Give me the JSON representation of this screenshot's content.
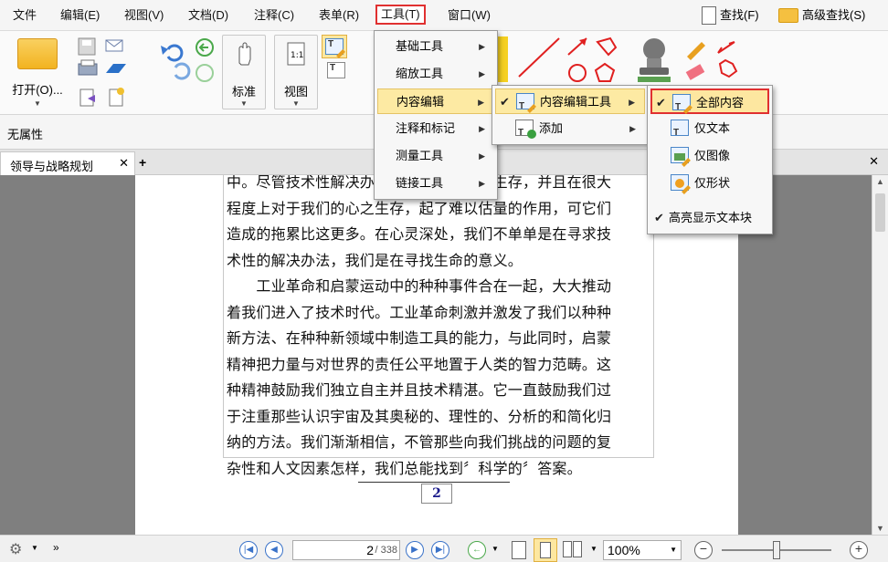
{
  "menubar": {
    "items": [
      "文件",
      "编辑(E)",
      "视图(V)",
      "文档(D)",
      "注释(C)",
      "表单(R)",
      "工具(T)",
      "窗口(W)"
    ],
    "search": "查找(F)",
    "advanced_search": "高级查找(S)"
  },
  "ribbon": {
    "open_label": "打开(O)...",
    "standard_label": "标准",
    "view_label": "视图"
  },
  "propbar": {
    "label": "无属性"
  },
  "tab": {
    "title": "领导与战略规划"
  },
  "tools_menu": {
    "items": [
      "基础工具",
      "缩放工具",
      "内容编辑",
      "注释和标记",
      "测量工具",
      "链接工具"
    ]
  },
  "content_edit_menu": {
    "items": [
      "内容编辑工具",
      "添加"
    ]
  },
  "content_edit_tools_menu": {
    "items": [
      "全部内容",
      "仅文本",
      "仅图像",
      "仅形状",
      "高亮显示文本块"
    ]
  },
  "document": {
    "lines": [
      "中。尽管技术性解决办法对我们的肉体之生存，并且在很大",
      "程度上对于我们的心之生存，起了难以估量的作用，可它们",
      "造成的拖累比这更多。在心灵深处，我们不单单是在寻求技",
      "术性的解决办法，我们是在寻找生命的意义。",
      "　　工业革命和启蒙运动中的种种事件合在一起，大大推动",
      "着我们进入了技术时代。工业革命刺激并激发了我们以种种",
      "新方法、在种种新领域中制造工具的能力，与此同时，启蒙",
      "精神把力量与对世界的责任公平地置于人类的智力范畴。这",
      "种精神鼓励我们独立自主并且技术精湛。它一直鼓励我们过",
      "于注重那些认识宇宙及其奥秘的、理性的、分析的和简化归",
      "纳的方法。我们渐渐相信，不管那些向我们挑战的问题的复",
      "杂性和人文因素怎样，我们总能找到〞科学的〞答案。"
    ],
    "page_number": "2"
  },
  "statusbar": {
    "current_page": "2",
    "total_pages": "/ 338",
    "zoom": "100%"
  }
}
